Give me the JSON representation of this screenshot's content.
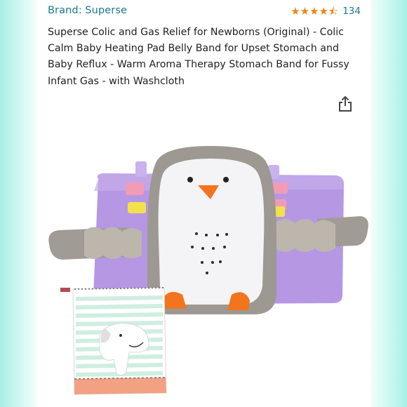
{
  "product": {
    "brand": "Brand: Superse",
    "rating_count": "134",
    "rating_value": 4.5,
    "title": "Superse Colic and Gas Relief for Newborns (Original) - Colic Calm Baby Heating Pad Belly Band for Upset Stomach and Baby Reflux - Warm Aroma Therapy Stomach Band for Fussy Infant Gas - with Washcloth"
  },
  "icons": {
    "share": "share-icon",
    "star": "star-icon"
  },
  "colors": {
    "link": "#1a7a8c",
    "star": "#e8871a",
    "text": "#222222",
    "band_purple": "#b898e6"
  }
}
